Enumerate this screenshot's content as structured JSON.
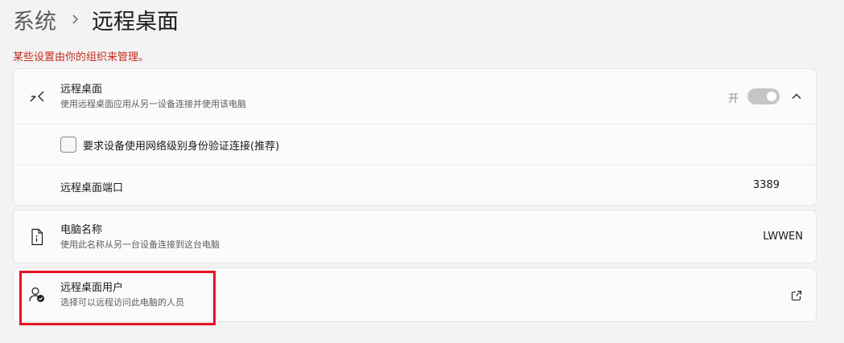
{
  "breadcrumb": {
    "parent": "系统",
    "current": "远程桌面"
  },
  "policy_note": "某些设置由你的组织来管理。",
  "remote_desktop": {
    "title": "远程桌面",
    "subtitle": "使用远程桌面应用从另一设备连接并使用该电脑",
    "toggle_state": "开",
    "toggle_on": true,
    "icon": "remote-desktop-icon",
    "nla_label": "要求设备使用网络级别身份验证连接(推荐)",
    "nla_checked": false,
    "port_label": "远程桌面端口",
    "port_value": "3389"
  },
  "pc_name": {
    "title": "电脑名称",
    "subtitle": "使用此名称从另一台设备连接到这台电脑",
    "value": "LWWEN",
    "icon": "pc-info-icon"
  },
  "remote_users": {
    "title": "远程桌面用户",
    "subtitle": "选择可以远程访问此电脑的人员",
    "icon": "user-check-icon",
    "action_icon": "open-external-icon"
  },
  "colors": {
    "background": "#f3f3f3",
    "card": "#fbfbfb",
    "policy_text": "#c42b1c",
    "toggle_disabled": "#c5c5c5",
    "highlight": "#e81123"
  }
}
